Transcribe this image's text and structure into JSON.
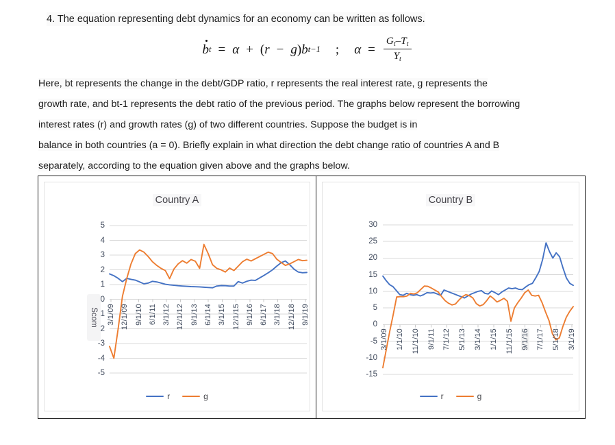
{
  "question": {
    "number_text": "4. The equation representing debt dynamics for an economy can be written as follows.",
    "equation": {
      "lhs_b": "b",
      "lhs_sub": "t",
      "eq1": "=",
      "alpha1": "α",
      "plus": "+",
      "open_paren": "(",
      "r": "r",
      "minus": "−",
      "g": "g",
      "close_paren": ")",
      "b2": "b",
      "b2_sub": "t−1",
      "semicolon": ";",
      "alpha2": "α",
      "eq2": "=",
      "numerator": "Gₜ−Tₜ",
      "num_G": "G",
      "num_G_sub": "t",
      "num_minus": "–",
      "num_T": "T",
      "num_T_sub": "t",
      "den_Y": "Y",
      "den_Y_sub": "t"
    },
    "body_lines": [
      "Here, bt represents the change in the debt/GDP ratio, r represents the real interest rate, g represents the",
      "growth rate, and bt-1 represents the debt ratio of the previous period. The graphs below represent the borrowing",
      "interest rates (r) and growth rates (g) of two different countries. Suppose the budget is in",
      "balance in both countries (a = 0). Briefly explain in what direction the debt change ratio of countries A and B",
      "separately, according to the equation given above and the graphs below."
    ]
  },
  "colors": {
    "series_r": "#4472C4",
    "series_g": "#ED7D31",
    "gridline": "#d9d9d9",
    "axis_text": "#404a5c",
    "frame": "#1c1c1c",
    "chart_border": "#e2e2e2"
  },
  "selection_artifact_label": "Scom",
  "chart_data": [
    {
      "type": "line",
      "title": "Country A",
      "xlabel": "",
      "ylabel": "",
      "ylim": [
        -5,
        5
      ],
      "yticks": [
        5,
        4,
        3,
        2,
        1,
        0,
        -1,
        -2,
        -3,
        -4,
        -5
      ],
      "ytick_labels": [
        "5",
        "4",
        "3",
        "2",
        "1",
        "0",
        "-1",
        "-2",
        "-3",
        "-4",
        "-5"
      ],
      "grid": true,
      "legend_position": "bottom",
      "categories": [
        "3/1/09",
        "12/1/09",
        "9/1/10",
        "6/1/11",
        "3/1/12",
        "12/1/12",
        "9/1/13",
        "6/1/14",
        "3/1/15",
        "12/1/15",
        "9/1/16",
        "6/1/17",
        "3/1/18",
        "12/1/18",
        "9/1/19"
      ],
      "series": [
        {
          "name": "r",
          "color": "#4472C4",
          "values": [
            1.72,
            1.6,
            1.42,
            1.2,
            1.42,
            1.35,
            1.3,
            1.18,
            1.05,
            1.1,
            1.22,
            1.18,
            1.1,
            1.02,
            0.98,
            0.95,
            0.92,
            0.9,
            0.88,
            0.86,
            0.85,
            0.84,
            0.82,
            0.8,
            0.78,
            0.9,
            0.93,
            0.92,
            0.9,
            0.9,
            1.2,
            1.1,
            1.22,
            1.3,
            1.28,
            1.45,
            1.62,
            1.8,
            2.0,
            2.25,
            2.48,
            2.6,
            2.35,
            2.05,
            1.85,
            1.8,
            1.82
          ]
        },
        {
          "name": "g",
          "color": "#ED7D31",
          "values": [
            -3.2,
            -4.0,
            -2.0,
            0.2,
            1.4,
            2.4,
            3.1,
            3.35,
            3.2,
            2.9,
            2.55,
            2.3,
            2.1,
            1.95,
            1.4,
            2.05,
            2.4,
            2.62,
            2.45,
            2.7,
            2.58,
            2.1,
            3.72,
            3.1,
            2.35,
            2.1,
            2.0,
            1.85,
            2.12,
            1.95,
            2.25,
            2.55,
            2.72,
            2.6,
            2.75,
            2.9,
            3.05,
            3.2,
            3.1,
            2.72,
            2.5,
            2.3,
            2.4,
            2.55,
            2.7,
            2.62,
            2.65
          ]
        }
      ]
    },
    {
      "type": "line",
      "title": "Country B",
      "xlabel": "",
      "ylabel": "",
      "ylim": [
        -15,
        30
      ],
      "yticks": [
        30,
        25,
        20,
        15,
        10,
        5,
        0,
        -5,
        -10,
        -15
      ],
      "ytick_labels": [
        "30",
        "25",
        "20",
        "15",
        "10",
        "5",
        "0",
        "-5",
        "-10",
        "-15"
      ],
      "grid": true,
      "legend_position": "bottom",
      "categories": [
        "3/1/09",
        "1/1/10",
        "11/1/10",
        "9/1/11",
        "7/1/12",
        "5/1/13",
        "3/1/14",
        "1/1/15",
        "11/1/15",
        "9/1/16",
        "7/1/17",
        "5/1/18",
        "3/1/19"
      ],
      "series": [
        {
          "name": "r",
          "color": "#4472C4",
          "values": [
            14.6,
            13.2,
            12.0,
            11.4,
            10.2,
            9.0,
            8.8,
            9.4,
            9.0,
            8.8,
            9.0,
            8.6,
            9.0,
            9.6,
            9.5,
            9.6,
            9.2,
            8.8,
            10.4,
            10.0,
            9.6,
            9.2,
            8.8,
            8.4,
            8.0,
            8.6,
            9.2,
            9.6,
            10.0,
            10.2,
            9.4,
            9.2,
            10.1,
            9.6,
            9.0,
            9.8,
            10.4,
            11.0,
            10.8,
            11.0,
            10.6,
            10.5,
            11.3,
            12.0,
            12.4,
            14.1,
            16.0,
            19.6,
            24.6,
            22.0,
            20.0,
            21.6,
            20.4,
            17.0,
            14.0,
            12.4,
            11.8
          ]
        },
        {
          "name": "g",
          "color": "#ED7D31",
          "values": [
            -13.0,
            -7.5,
            -2.0,
            3.0,
            8.3,
            8.4,
            8.4,
            8.6,
            9.4,
            9.2,
            9.6,
            10.6,
            11.6,
            11.5,
            11.0,
            10.4,
            9.8,
            8.4,
            7.2,
            6.4,
            5.9,
            6.2,
            7.4,
            8.4,
            9.0,
            8.7,
            8.0,
            6.3,
            5.6,
            6.0,
            7.2,
            8.6,
            7.8,
            6.8,
            7.3,
            7.9,
            7.0,
            1.0,
            5.0,
            6.6,
            8.0,
            9.6,
            10.4,
            8.8,
            8.6,
            8.8,
            6.6,
            3.8,
            1.2,
            -2.8,
            -4.6,
            -4.0,
            -0.6,
            2.2,
            4.0,
            5.4
          ]
        }
      ]
    }
  ],
  "legend": {
    "items": [
      {
        "label": "r",
        "color": "#4472C4"
      },
      {
        "label": "g",
        "color": "#ED7D31"
      }
    ]
  }
}
